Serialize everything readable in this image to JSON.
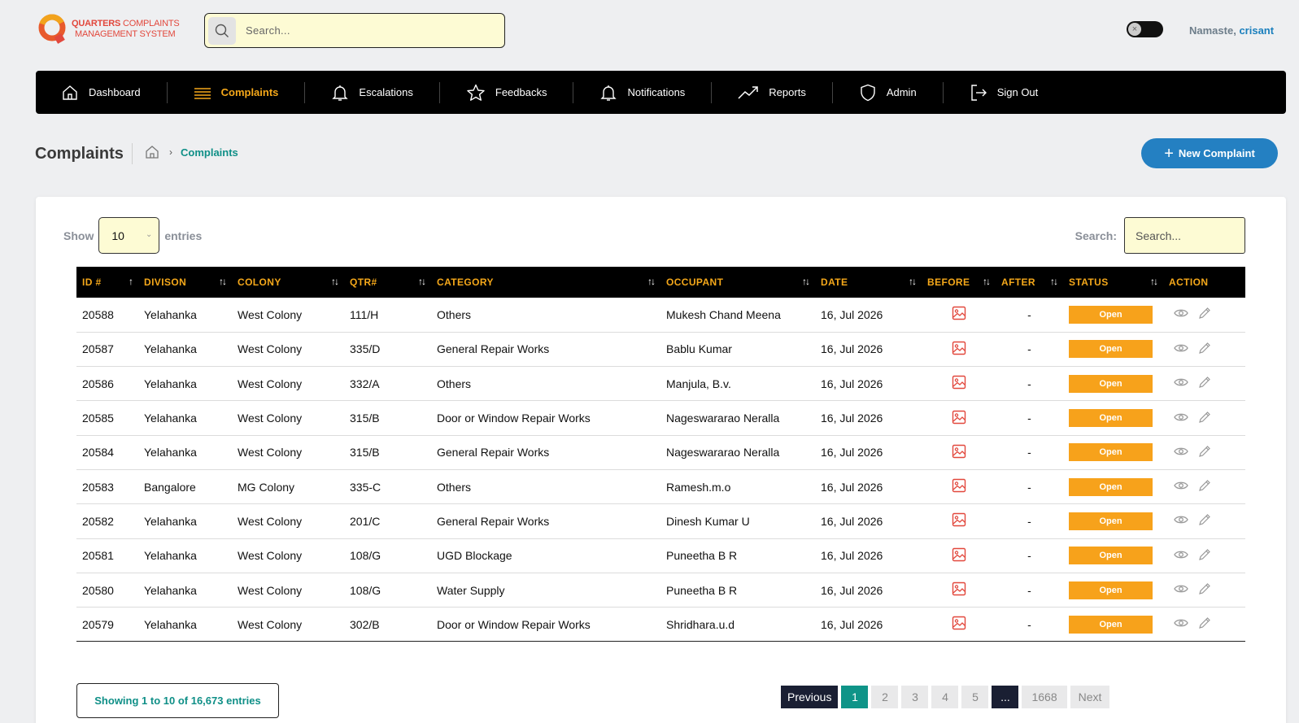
{
  "app": {
    "logo_line1_bold": "QUARTERS",
    "logo_line1_rest": " COMPLAINTS",
    "logo_line2": "MANAGEMENT SYSTEM",
    "search_placeholder": "Search...",
    "greeting_prefix": "Namaste,",
    "user_name": "crisant"
  },
  "nav": [
    {
      "label": "Dashboard",
      "icon": "home-icon",
      "active": false
    },
    {
      "label": "Complaints",
      "icon": "list-icon",
      "active": true
    },
    {
      "label": "Escalations",
      "icon": "bell-icon",
      "active": false
    },
    {
      "label": "Feedbacks",
      "icon": "star-icon",
      "active": false
    },
    {
      "label": "Notifications",
      "icon": "bell-icon",
      "active": false
    },
    {
      "label": "Reports",
      "icon": "trend-icon",
      "active": false
    },
    {
      "label": "Admin",
      "icon": "shield-icon",
      "active": false
    },
    {
      "label": "Sign Out",
      "icon": "signout-icon",
      "active": false
    }
  ],
  "page": {
    "title": "Complaints",
    "breadcrumb_current": "Complaints",
    "new_button": "New Complaint"
  },
  "table_controls": {
    "show_label": "Show",
    "entries_value": "10",
    "entries_label": "entries",
    "search_label": "Search:",
    "search_placeholder": "Search..."
  },
  "columns": [
    "ID #",
    "DIVISON",
    "COLONY",
    "QTR#",
    "CATEGORY",
    "OCCUPANT",
    "DATE",
    "BEFORE",
    "AFTER",
    "STATUS",
    "ACTION"
  ],
  "rows": [
    {
      "id": "20588",
      "division": "Yelahanka",
      "colony": "West Colony",
      "qtr": "111/H",
      "category": "Others",
      "occupant": "Mukesh Chand Meena",
      "date": "16, Jul 2026",
      "after": "-",
      "status": "Open"
    },
    {
      "id": "20587",
      "division": "Yelahanka",
      "colony": "West Colony",
      "qtr": "335/D",
      "category": "General Repair Works",
      "occupant": "Bablu Kumar",
      "date": "16, Jul 2026",
      "after": "-",
      "status": "Open"
    },
    {
      "id": "20586",
      "division": "Yelahanka",
      "colony": "West Colony",
      "qtr": "332/A",
      "category": "Others",
      "occupant": "Manjula, B.v.",
      "date": "16, Jul 2026",
      "after": "-",
      "status": "Open"
    },
    {
      "id": "20585",
      "division": "Yelahanka",
      "colony": "West Colony",
      "qtr": "315/B",
      "category": "Door or Window Repair Works",
      "occupant": "Nageswararao Neralla",
      "date": "16, Jul 2026",
      "after": "-",
      "status": "Open"
    },
    {
      "id": "20584",
      "division": "Yelahanka",
      "colony": "West Colony",
      "qtr": "315/B",
      "category": "General Repair Works",
      "occupant": "Nageswararao Neralla",
      "date": "16, Jul 2026",
      "after": "-",
      "status": "Open"
    },
    {
      "id": "20583",
      "division": "Bangalore",
      "colony": "MG Colony",
      "qtr": "335-C",
      "category": "Others",
      "occupant": "Ramesh.m.o",
      "date": "16, Jul 2026",
      "after": "-",
      "status": "Open"
    },
    {
      "id": "20582",
      "division": "Yelahanka",
      "colony": "West Colony",
      "qtr": "201/C",
      "category": "General Repair Works",
      "occupant": "Dinesh Kumar U",
      "date": "16, Jul 2026",
      "after": "-",
      "status": "Open"
    },
    {
      "id": "20581",
      "division": "Yelahanka",
      "colony": "West Colony",
      "qtr": "108/G",
      "category": "UGD Blockage",
      "occupant": "Puneetha B R",
      "date": "16, Jul 2026",
      "after": "-",
      "status": "Open"
    },
    {
      "id": "20580",
      "division": "Yelahanka",
      "colony": "West Colony",
      "qtr": "108/G",
      "category": "Water Supply",
      "occupant": "Puneetha B R",
      "date": "16, Jul 2026",
      "after": "-",
      "status": "Open"
    },
    {
      "id": "20579",
      "division": "Yelahanka",
      "colony": "West Colony",
      "qtr": "302/B",
      "category": "Door or Window Repair Works",
      "occupant": "Shridhara.u.d",
      "date": "16, Jul 2026",
      "after": "-",
      "status": "Open"
    }
  ],
  "footer": {
    "showing": "Showing 1 to 10 of 16,673 entries",
    "previous": "Previous",
    "pages": [
      "1",
      "2",
      "3",
      "4",
      "5",
      "...",
      "1668"
    ],
    "next": "Next"
  },
  "colors": {
    "accent_orange": "#f5a81a",
    "teal": "#0f8f87",
    "blue_button": "#2480c2",
    "status_open": "#f7a21b"
  }
}
